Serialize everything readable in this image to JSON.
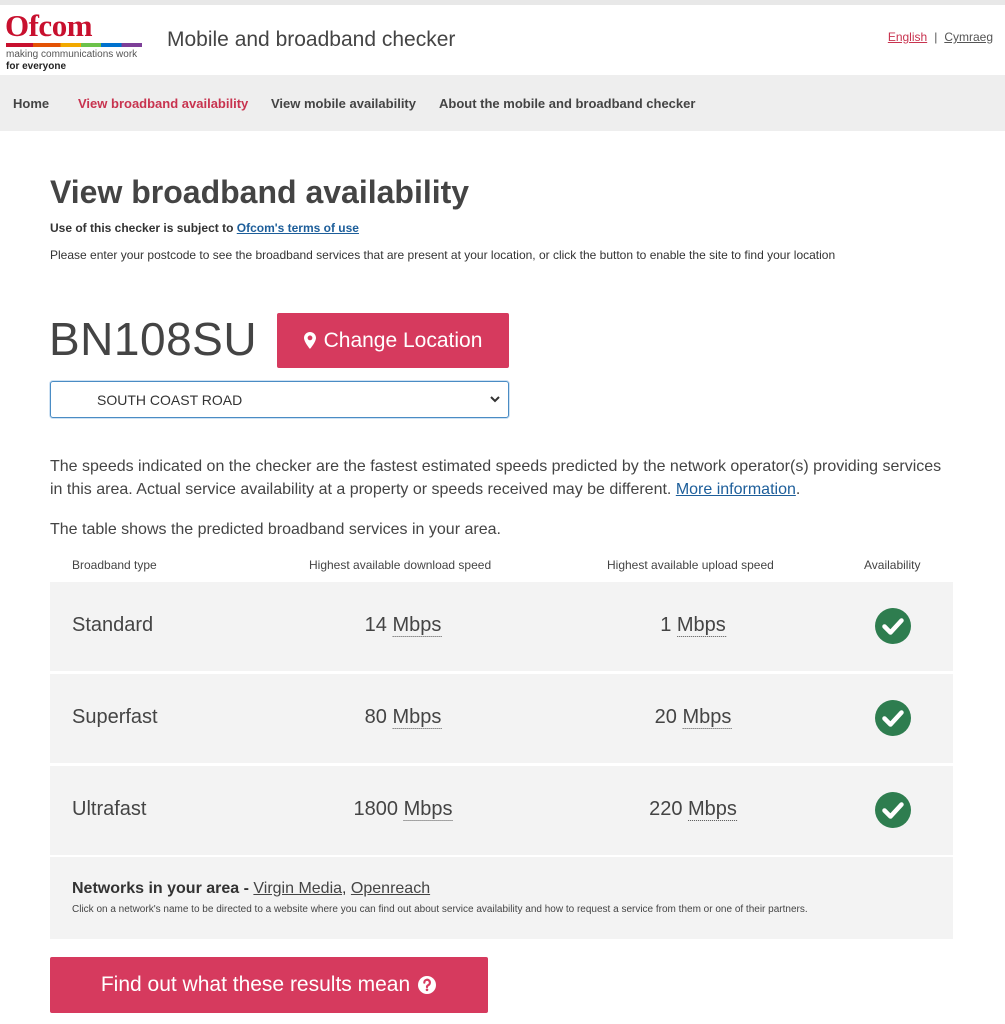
{
  "logo": {
    "word": "Ofcom",
    "tagline1": "making communications work",
    "tagline2": "for everyone"
  },
  "header": {
    "title": "Mobile and broadband checker",
    "lang_english": "English",
    "lang_sep": "|",
    "lang_welsh": "Cymraeg"
  },
  "nav": {
    "items": [
      {
        "label": "Home",
        "active": false
      },
      {
        "label": "View broadband availability",
        "active": true
      },
      {
        "label": "View mobile availability",
        "active": false
      },
      {
        "label": "About the mobile and broadband checker",
        "active": false
      }
    ]
  },
  "main": {
    "title": "View broadband availability",
    "terms_prefix": "Use of this checker is subject to ",
    "terms_link": "Ofcom's terms of use",
    "intro": "Please enter your postcode to see the broadband services that are present at your location, or click the button to enable the site to find your location",
    "postcode": "BN108SU",
    "change_location": "Change Location",
    "address_selected": "SOUTH COAST ROAD",
    "note_text": "The speeds indicated on the checker are the fastest estimated speeds predicted by the network operator(s) providing services in this area. Actual service availability at a property or speeds received may be different. ",
    "note_link": "More information",
    "note_end": ".",
    "table_intro": "The table shows the predicted broadband services in your area."
  },
  "table": {
    "headers": [
      "Broadband type",
      "Highest available download speed",
      "Highest available upload speed",
      "Availability"
    ],
    "rows": [
      {
        "type": "Standard",
        "download": "14",
        "upload": "1",
        "unit": "Mbps",
        "available": true
      },
      {
        "type": "Superfast",
        "download": "80",
        "upload": "20",
        "unit": "Mbps",
        "available": true
      },
      {
        "type": "Ultrafast",
        "download": "1800",
        "upload": "220",
        "unit": "Mbps",
        "available": true
      }
    ]
  },
  "networks": {
    "label": "Networks in your area - ",
    "links": [
      "Virgin Media",
      "Openreach"
    ],
    "separator": ", ",
    "note": "Click on a network's name to be directed to a website where you can find out about service availability and how to request a service from them or one of their partners."
  },
  "cta": {
    "label": "Find out what these results mean"
  },
  "colors": {
    "brand": "#c8102e",
    "button": "#d63a5e",
    "check": "#2e7d4f",
    "link": "#1d5e9a"
  }
}
